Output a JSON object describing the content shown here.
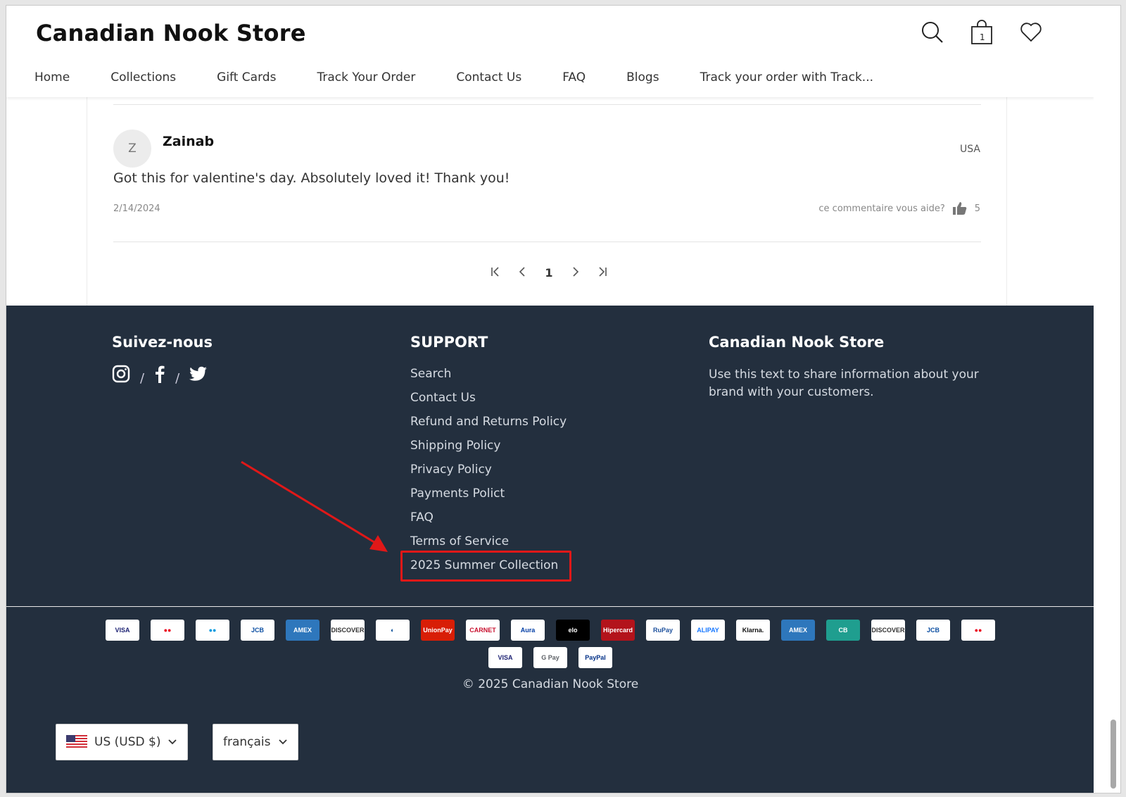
{
  "header": {
    "brand": "Canadian Nook Store",
    "cart_count": "1",
    "nav": [
      "Home",
      "Collections",
      "Gift Cards",
      "Track Your Order",
      "Contact Us",
      "FAQ",
      "Blogs",
      "Track your order with Track..."
    ]
  },
  "review": {
    "avatar_letter": "Z",
    "name": "Zainab",
    "country": "USA",
    "body": "Got this for valentine's day. Absolutely loved it! Thank you!",
    "date": "2/14/2024",
    "helpful_question": "ce commentaire vous aide?",
    "helpful_count": "5"
  },
  "pagination": {
    "first": "K",
    "prev": "‹",
    "current": "1",
    "next": "›",
    "last": "›I"
  },
  "footer": {
    "follow_title": "Suivez-nous",
    "social_sep": "/",
    "support_title": "SUPPORT",
    "support_links": [
      "Search",
      "Contact Us",
      "Refund and Returns Policy",
      "Shipping Policy",
      "Privacy Policy",
      "Payments Polict",
      "FAQ",
      "Terms of Service",
      "2025 Summer Collection"
    ],
    "store_title": "Canadian Nook Store",
    "store_text": "Use this text to share information about your brand with your customers.",
    "copyright": "© 2025 Canadian Nook Store",
    "currency": "US (USD $)",
    "language": "français"
  },
  "payments": [
    {
      "label": "VISA",
      "color": "#1a1f71"
    },
    {
      "label": "●●",
      "color": "#eb001b"
    },
    {
      "label": "●●",
      "color": "#0099df"
    },
    {
      "label": "JCB",
      "color": "#0b4ea2"
    },
    {
      "label": "AMEX",
      "color": "#ffffff",
      "bg": "#2e77bc"
    },
    {
      "label": "DISCOVER",
      "color": "#333333"
    },
    {
      "label": "◐",
      "color": "#004a97"
    },
    {
      "label": "UnionPay",
      "color": "#ffffff",
      "bg": "#d81e06"
    },
    {
      "label": "CARNET",
      "color": "#c8102e"
    },
    {
      "label": "Aura",
      "color": "#003da5"
    },
    {
      "label": "elo",
      "color": "#ffffff",
      "bg": "#000000"
    },
    {
      "label": "Hipercard",
      "color": "#ffffff",
      "bg": "#b3131b"
    },
    {
      "label": "RuPay",
      "color": "#1b4f9c"
    },
    {
      "label": "ALIPAY",
      "color": "#1677ff"
    },
    {
      "label": "Klarna.",
      "color": "#111111"
    },
    {
      "label": "AMEX",
      "color": "#ffffff",
      "bg": "#2e77bc"
    },
    {
      "label": "CB",
      "color": "#ffffff",
      "bg": "#1f9e8f"
    },
    {
      "label": "DISCOVER",
      "color": "#333333"
    },
    {
      "label": "JCB",
      "color": "#0b4ea2"
    },
    {
      "label": "●●",
      "color": "#eb001b"
    },
    {
      "label": "VISA",
      "color": "#1a1f71"
    },
    {
      "label": "G Pay",
      "color": "#5f6368"
    },
    {
      "label": "PayPal",
      "color": "#003087"
    }
  ],
  "colors": {
    "footer_bg": "#232f3e",
    "highlight": "#e01818"
  }
}
